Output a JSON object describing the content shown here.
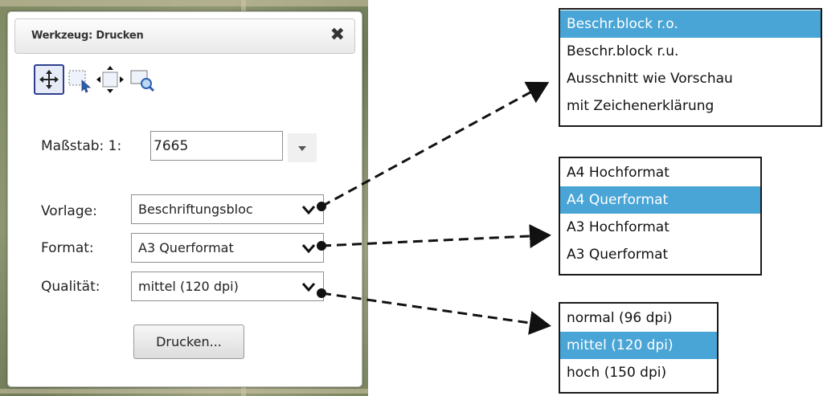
{
  "window": {
    "title": "Werkzeug: Drucken",
    "close_icon": "close-icon"
  },
  "tools": [
    "pan-tool-icon",
    "select-area-tool-icon",
    "move-frame-tool-icon",
    "zoom-area-tool-icon"
  ],
  "form": {
    "scale_label": "Maßstab: 1:",
    "scale_value": "7665",
    "template_label": "Vorlage:",
    "template_value": "Beschriftungsbloc",
    "format_label": "Format:",
    "format_value": "A3 Querformat",
    "quality_label": "Qualität:",
    "quality_value": "mittel (120 dpi)",
    "print_button": "Drucken..."
  },
  "dropdowns": {
    "template_options": [
      "Beschr.block r.o.",
      "Beschr.block r.u.",
      "Ausschnitt wie Vorschau",
      "mit Zeichenerklärung"
    ],
    "template_selected": "Beschr.block r.o.",
    "format_options": [
      "A4 Hochformat",
      "A4 Querformat",
      "A3 Hochformat",
      "A3 Querformat"
    ],
    "format_selected": "A4 Querformat",
    "quality_options": [
      "normal (96 dpi)",
      "mittel (120 dpi)",
      "hoch (150 dpi)"
    ],
    "quality_selected": "mittel (120 dpi)"
  },
  "colors": {
    "highlight": "#4aa5d7",
    "active_tool_border": "#2f3f8f"
  }
}
